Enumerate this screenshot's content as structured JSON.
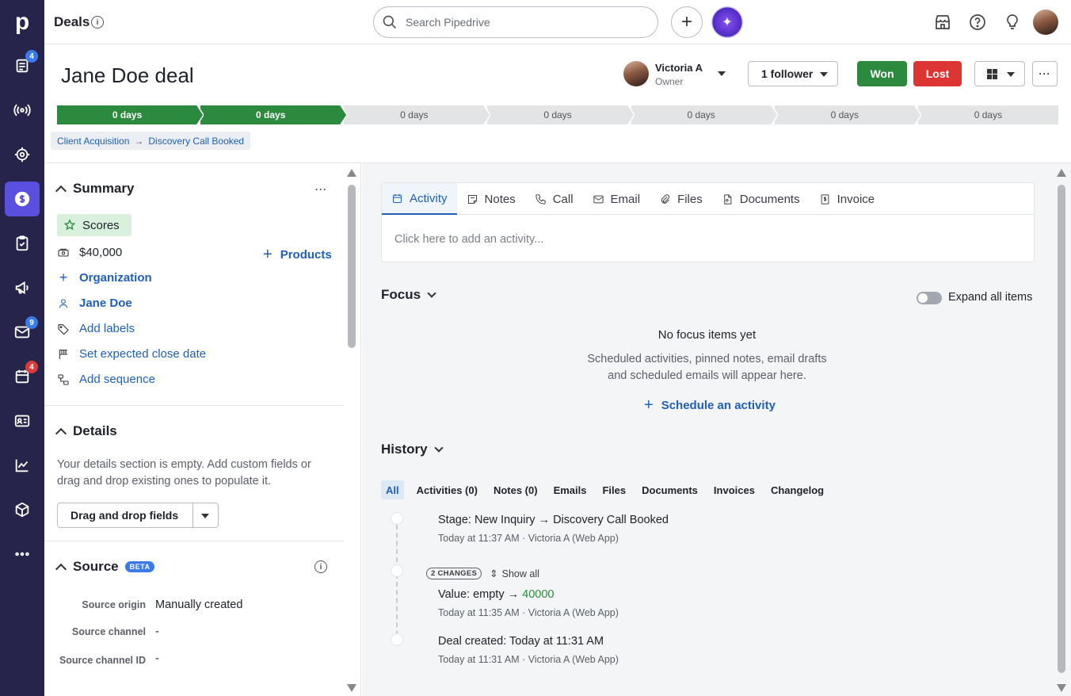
{
  "app": {
    "logo": "p",
    "section_title": "Deals"
  },
  "nav": [
    {
      "icon": "deals-list-icon",
      "badge": "4",
      "badge_color": "#3b7be9"
    },
    {
      "icon": "broadcast-icon",
      "badge": ""
    },
    {
      "icon": "target-icon",
      "badge": ""
    },
    {
      "icon": "dollar-icon",
      "badge": "",
      "active": true
    },
    {
      "icon": "tasks-icon",
      "badge": ""
    },
    {
      "icon": "megaphone-icon",
      "badge": ""
    },
    {
      "icon": "mail-icon",
      "badge": "9",
      "badge_color": "#3b7be9"
    },
    {
      "icon": "calendar-icon",
      "badge": "4",
      "badge_color": "#d93b3b"
    },
    {
      "icon": "contacts-icon",
      "badge": ""
    },
    {
      "icon": "insights-icon",
      "badge": ""
    },
    {
      "icon": "products-icon",
      "badge": ""
    },
    {
      "icon": "more-icon",
      "badge": ""
    }
  ],
  "search": {
    "placeholder": "Search Pipedrive"
  },
  "deal": {
    "title": "Jane Doe deal",
    "owner_name": "Victoria A",
    "owner_role": "Owner",
    "follower_label": "1 follower",
    "won_label": "Won",
    "lost_label": "Lost"
  },
  "pipeline": [
    {
      "label": "0 days",
      "done": true
    },
    {
      "label": "0 days",
      "done": true
    },
    {
      "label": "0 days",
      "done": false
    },
    {
      "label": "0 days",
      "done": false
    },
    {
      "label": "0 days",
      "done": false
    },
    {
      "label": "0 days",
      "done": false
    },
    {
      "label": "0 days",
      "done": false
    }
  ],
  "breadcrumb": {
    "pipeline": "Client Acquisition",
    "stage": "Discovery Call Booked"
  },
  "summary": {
    "heading": "Summary",
    "scores": "Scores",
    "value": "$40,000",
    "products": "Products",
    "organization": "Organization",
    "person": "Jane Doe",
    "labels": "Add labels",
    "close_date": "Set expected close date",
    "sequence": "Add sequence"
  },
  "details": {
    "heading": "Details",
    "empty_text": "Your details section is empty. Add custom fields or drag and drop existing ones to populate it.",
    "dnd_label": "Drag and drop fields"
  },
  "source": {
    "heading": "Source",
    "beta": "BETA",
    "rows": [
      {
        "label": "Source origin",
        "value": "Manually created"
      },
      {
        "label": "Source channel",
        "value": "-"
      },
      {
        "label": "Source channel ID",
        "value": "-"
      }
    ]
  },
  "activity_tabs": [
    {
      "label": "Activity",
      "icon": "calendar-icon",
      "active": true
    },
    {
      "label": "Notes",
      "icon": "notes-icon"
    },
    {
      "label": "Call",
      "icon": "phone-icon"
    },
    {
      "label": "Email",
      "icon": "mail-icon"
    },
    {
      "label": "Files",
      "icon": "paperclip-icon"
    },
    {
      "label": "Documents",
      "icon": "document-icon"
    },
    {
      "label": "Invoice",
      "icon": "invoice-icon"
    }
  ],
  "activity_placeholder": "Click here to add an activity...",
  "focus": {
    "heading": "Focus",
    "expand_label": "Expand all items",
    "empty_title": "No focus items yet",
    "empty_line1": "Scheduled activities, pinned notes, email drafts",
    "empty_line2": "and scheduled emails will appear here.",
    "schedule_label": "Schedule an activity"
  },
  "history": {
    "heading": "History",
    "tabs": [
      "All",
      "Activities (0)",
      "Notes (0)",
      "Emails",
      "Files",
      "Documents",
      "Invoices",
      "Changelog"
    ],
    "items": [
      {
        "label": "Stage",
        "text": "New Inquiry → Discovery Call Booked",
        "meta": "Today at 11:37 AM · Victoria A (Web App)"
      },
      {
        "changes": "2 CHANGES",
        "show_all": "Show all",
        "label": "Value",
        "text_before": "empty →",
        "text_value": "40000",
        "meta": "Today at 11:35 AM · Victoria A (Web App)"
      },
      {
        "label": "Deal created",
        "text": "Today at 11:31 AM",
        "meta": "Today at 11:31 AM · Victoria A (Web App)"
      }
    ]
  }
}
